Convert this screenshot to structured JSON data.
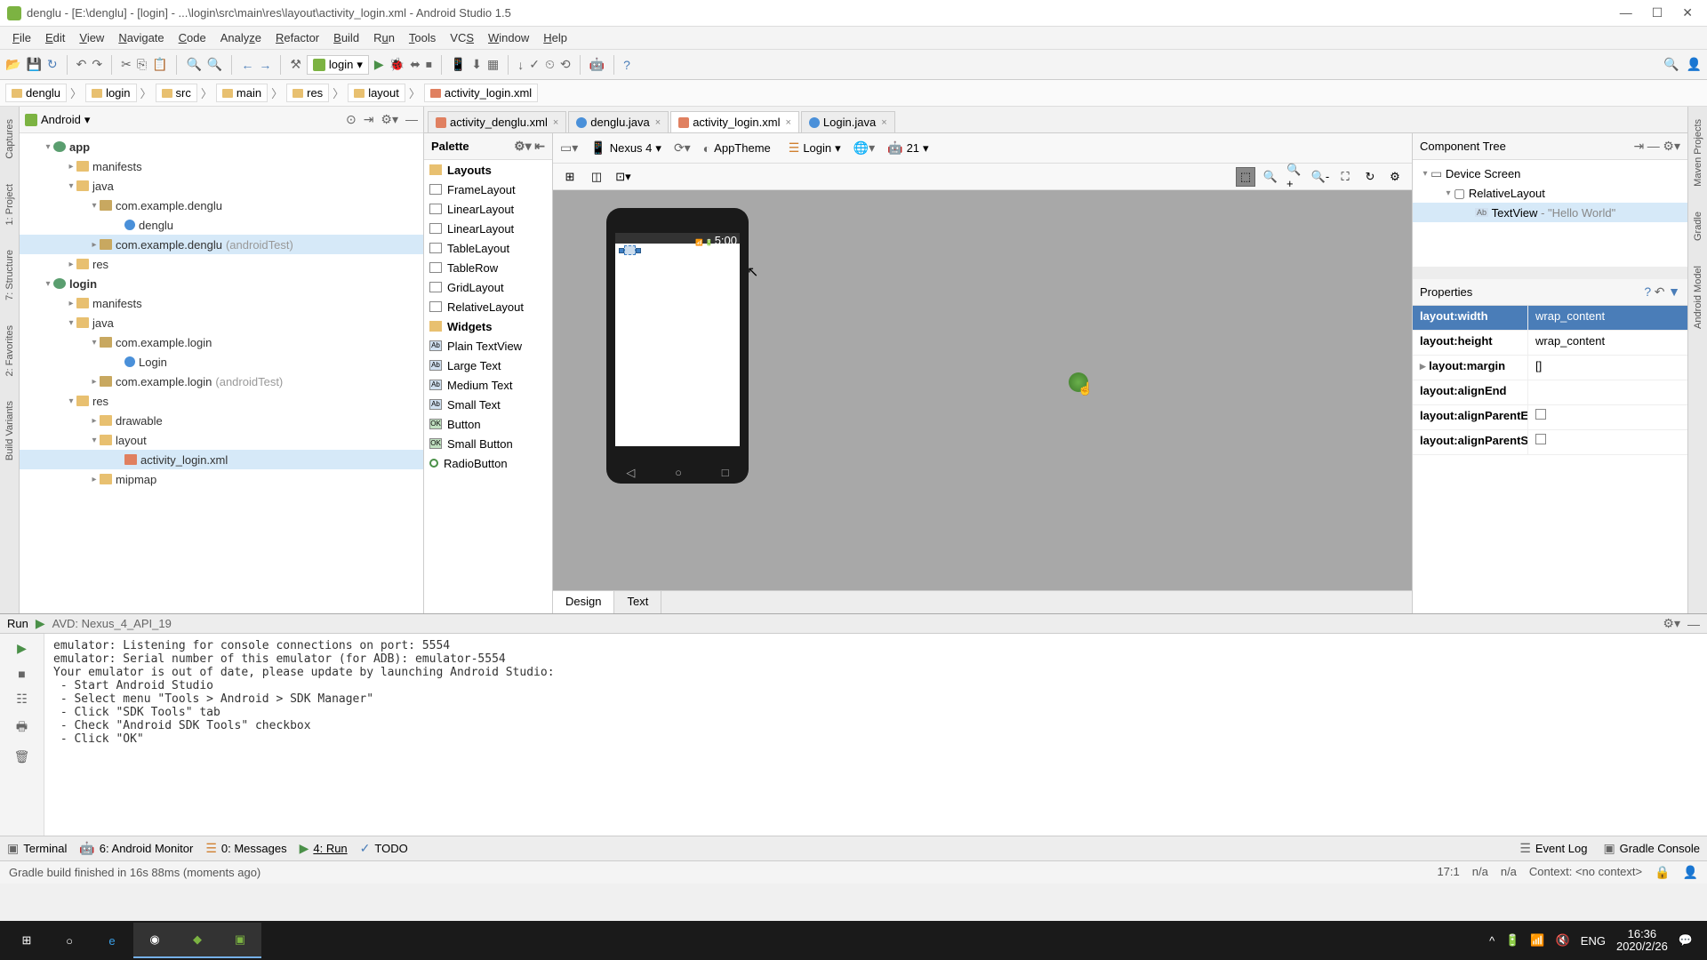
{
  "window": {
    "title": "denglu - [E:\\denglu] - [login] - ...\\login\\src\\main\\res\\layout\\activity_login.xml - Android Studio 1.5"
  },
  "menu": [
    "File",
    "Edit",
    "View",
    "Navigate",
    "Code",
    "Analyze",
    "Refactor",
    "Build",
    "Run",
    "Tools",
    "VCS",
    "Window",
    "Help"
  ],
  "toolbar": {
    "config": "login"
  },
  "breadcrumb": [
    "denglu",
    "login",
    "src",
    "main",
    "res",
    "layout",
    "activity_login.xml"
  ],
  "project": {
    "view": "Android",
    "tree": {
      "app": "app",
      "manifests1": "manifests",
      "java1": "java",
      "pkg1": "com.example.denglu",
      "cls1": "denglu",
      "pkg1b": "com.example.denglu",
      "pkg1b_hint": "(androidTest)",
      "res1": "res",
      "login": "login",
      "manifests2": "manifests",
      "java2": "java",
      "pkg2": "com.example.login",
      "cls2": "Login",
      "pkg2b": "com.example.login",
      "pkg2b_hint": "(androidTest)",
      "res2": "res",
      "drawable": "drawable",
      "layout": "layout",
      "axml": "activity_login.xml",
      "mipmap": "mipmap"
    }
  },
  "editor_tabs": [
    {
      "label": "activity_denglu.xml",
      "type": "xml",
      "active": false
    },
    {
      "label": "denglu.java",
      "type": "java",
      "active": false
    },
    {
      "label": "activity_login.xml",
      "type": "xml",
      "active": true
    },
    {
      "label": "Login.java",
      "type": "java",
      "active": false
    }
  ],
  "palette": {
    "title": "Palette",
    "groups": {
      "layouts_hdr": "Layouts",
      "layouts": [
        "FrameLayout",
        "LinearLayout",
        "LinearLayout",
        "TableLayout",
        "TableRow",
        "GridLayout",
        "RelativeLayout"
      ],
      "widgets_hdr": "Widgets",
      "widgets": [
        "Plain TextView",
        "Large Text",
        "Medium Text",
        "Small Text",
        "Button",
        "Small Button",
        "RadioButton"
      ]
    }
  },
  "canvas_toolbar": {
    "device": "Nexus 4",
    "theme": "AppTheme",
    "activity": "Login",
    "api": "21"
  },
  "phone": {
    "statusbar_time": "5:00"
  },
  "design_tabs": {
    "design": "Design",
    "text": "Text"
  },
  "component_tree": {
    "title": "Component Tree",
    "root": "Device Screen",
    "rel": "RelativeLayout",
    "tv": "TextView",
    "tv_hint": "- \"Hello World\""
  },
  "properties": {
    "title": "Properties",
    "rows": [
      {
        "k": "layout:width",
        "v": "wrap_content",
        "sel": true
      },
      {
        "k": "layout:height",
        "v": "wrap_content"
      },
      {
        "k": "layout:margin",
        "v": "[]",
        "exp": true
      },
      {
        "k": "layout:alignEnd",
        "v": ""
      },
      {
        "k": "layout:alignParentEnd",
        "v": "",
        "chk": true
      },
      {
        "k": "layout:alignParentStart",
        "v": "",
        "chk": true
      }
    ]
  },
  "run": {
    "tab": "Run",
    "config": "AVD: Nexus_4_API_19",
    "output": "emulator: Listening for console connections on port: 5554\nemulator: Serial number of this emulator (for ADB): emulator-5554\nYour emulator is out of date, please update by launching Android Studio:\n - Start Android Studio\n - Select menu \"Tools > Android > SDK Manager\"\n - Click \"SDK Tools\" tab\n - Check \"Android SDK Tools\" checkbox\n - Click \"OK\""
  },
  "bottom_tabs": {
    "terminal": "Terminal",
    "monitor": "6: Android Monitor",
    "messages": "0: Messages",
    "run": "4: Run",
    "todo": "TODO",
    "eventlog": "Event Log",
    "gradle": "Gradle Console"
  },
  "status": {
    "msg": "Gradle build finished in 16s 88ms (moments ago)",
    "pos": "17:1",
    "insert": "n/a",
    "enc": "n/a",
    "context": "Context: <no context>"
  },
  "gutters": {
    "captures": "Captures",
    "project": "1: Project",
    "structure": "7: Structure",
    "favorites": "2: Favorites",
    "buildvar": "Build Variants",
    "maven": "Maven Projects",
    "gradle": "Gradle",
    "androidmodel": "Android Model"
  },
  "taskbar": {
    "lang": "ENG",
    "time": "16:36",
    "date": "2020/2/26"
  }
}
